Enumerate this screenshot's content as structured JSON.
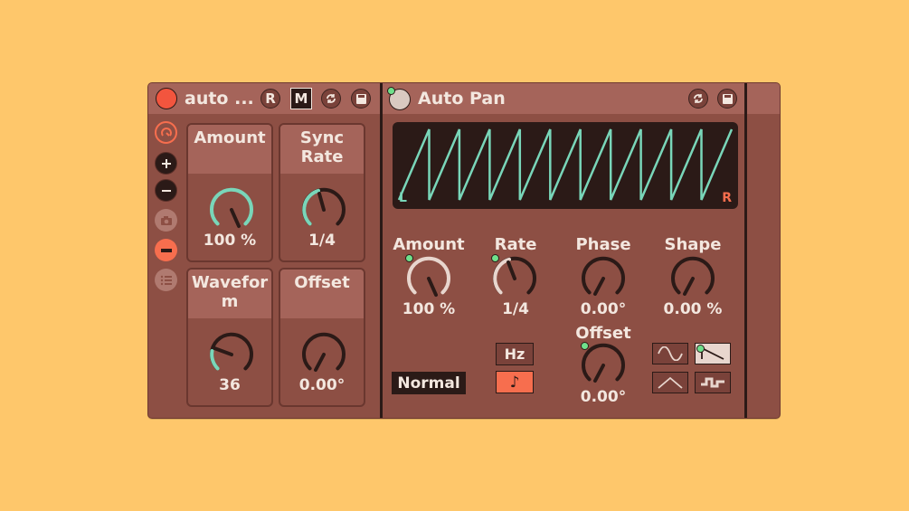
{
  "rack": {
    "title": "auto ...",
    "r_label": "R",
    "m_label": "M",
    "macros": [
      {
        "label": "Amount",
        "value": "100 %"
      },
      {
        "label": "Sync Rate",
        "value": "1/4"
      },
      {
        "label": "Wavefor m",
        "value": "36"
      },
      {
        "label": "Offset",
        "value": "0.00°"
      }
    ]
  },
  "autopan": {
    "title": "Auto Pan",
    "scope": {
      "left": "L",
      "right": "R",
      "waveform": "sawtooth",
      "cycles": 11
    },
    "params": [
      {
        "label": "Amount",
        "value": "100 %",
        "level": 1.0
      },
      {
        "label": "Rate",
        "value": "1/4",
        "level": 0.45
      },
      {
        "label": "Phase",
        "value": "0.00°",
        "level": 0.0
      },
      {
        "label": "Shape",
        "value": "0.00 %",
        "level": 0.0
      },
      {
        "label": "Offset",
        "value": "0.00°",
        "level": 0.0
      }
    ],
    "mode": "Normal",
    "rate_mode_hz": "Hz",
    "rate_mode_sync": "♪",
    "waveforms": [
      "sine-icon",
      "sawtooth-icon",
      "triangle-icon",
      "random-icon"
    ],
    "selected_waveform": "sawtooth-icon"
  },
  "colors": {
    "background": "#fec76b",
    "device": "#8d4f44",
    "header": "#a5645a",
    "accent_knob": "#79d6b9",
    "active": "#f76e4e",
    "led": "#6fe08c"
  }
}
